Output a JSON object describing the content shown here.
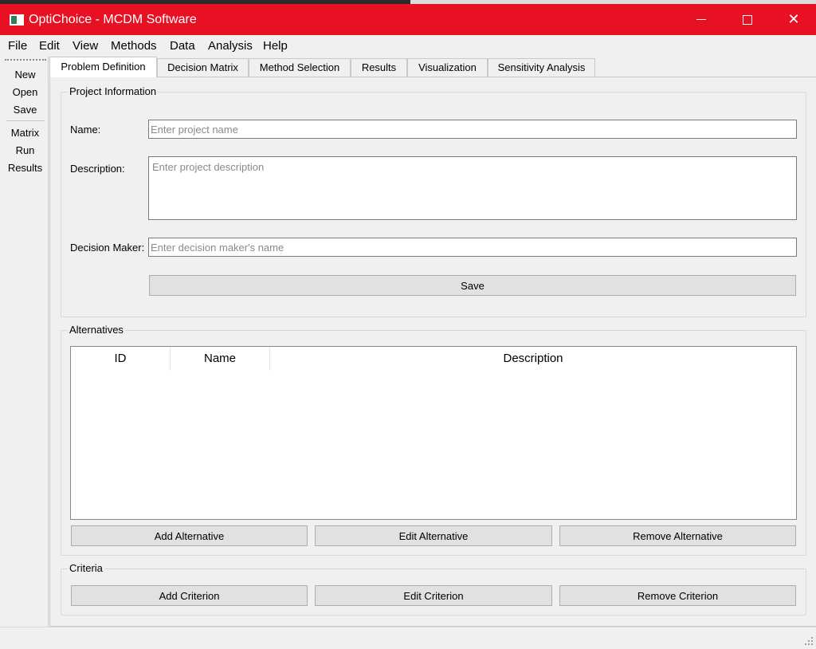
{
  "window": {
    "title": "OptiChoice - MCDM Software",
    "accent_color": "#e81123",
    "app_icon": "app-window-icon",
    "controls": {
      "minimize_icon": "minimize-icon",
      "maximize_icon": "maximize-icon",
      "close_icon": "close-icon",
      "close_glyph": "✕"
    }
  },
  "menubar": [
    "File",
    "Edit",
    "View",
    "Methods",
    "Data",
    "Analysis",
    "Help"
  ],
  "toolbar": {
    "group1": [
      "New",
      "Open",
      "Save"
    ],
    "group2": [
      "Matrix",
      "Run",
      "Results"
    ]
  },
  "tabs": [
    "Problem Definition",
    "Decision Matrix",
    "Method Selection",
    "Results",
    "Visualization",
    "Sensitivity Analysis"
  ],
  "active_tab": "Problem Definition",
  "project_info": {
    "title": "Project Information",
    "name_label": "Name:",
    "name_placeholder": "Enter project name",
    "name_value": "",
    "description_label": "Description:",
    "description_placeholder": "Enter project description",
    "description_value": "",
    "decision_maker_label": "Decision Maker:",
    "decision_maker_placeholder": "Enter decision maker's name",
    "decision_maker_value": "",
    "save_label": "Save"
  },
  "alternatives": {
    "title": "Alternatives",
    "columns": [
      "ID",
      "Name",
      "Description"
    ],
    "rows": [],
    "add_label": "Add Alternative",
    "edit_label": "Edit Alternative",
    "remove_label": "Remove Alternative"
  },
  "criteria": {
    "title": "Criteria",
    "add_label": "Add Criterion",
    "edit_label": "Edit Criterion",
    "remove_label": "Remove Criterion"
  }
}
